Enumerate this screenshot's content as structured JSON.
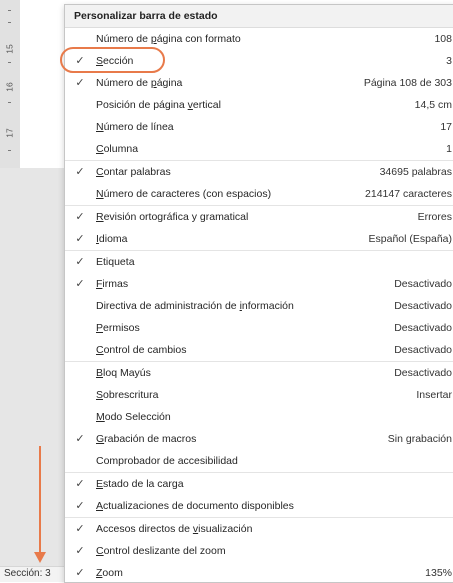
{
  "ruler": {
    "ticks": [
      "15",
      "16",
      "17"
    ]
  },
  "statusbar": {
    "section_label": "Sección: 3"
  },
  "menu": {
    "title": "Personalizar barra de estado",
    "items": [
      {
        "pre": "Número de ",
        "u": "p",
        "post": "ágina con formato",
        "value": "108",
        "checked": false,
        "sep": false
      },
      {
        "pre": "",
        "u": "S",
        "post": "ección",
        "value": "3",
        "checked": true,
        "sep": false
      },
      {
        "pre": "Número de ",
        "u": "p",
        "post": "ágina",
        "value": "Página 108 de 303",
        "checked": true,
        "sep": false
      },
      {
        "pre": "Posición de página ",
        "u": "v",
        "post": "ertical",
        "value": "14,5 cm",
        "checked": false,
        "sep": false
      },
      {
        "pre": "",
        "u": "N",
        "post": "úmero de línea",
        "value": "17",
        "checked": false,
        "sep": false
      },
      {
        "pre": "",
        "u": "C",
        "post": "olumna",
        "value": "1",
        "checked": false,
        "sep": false
      },
      {
        "pre": "",
        "u": "C",
        "post": "ontar palabras",
        "value": "34695 palabras",
        "checked": true,
        "sep": true
      },
      {
        "pre": "",
        "u": "N",
        "post": "úmero de caracteres (con espacios)",
        "value": "214147 caracteres",
        "checked": false,
        "sep": false
      },
      {
        "pre": "",
        "u": "R",
        "post": "evisión ortográfica y gramatical",
        "value": "Errores",
        "checked": true,
        "sep": true
      },
      {
        "pre": "",
        "u": "I",
        "post": "dioma",
        "value": "Español (España)",
        "checked": true,
        "sep": false
      },
      {
        "pre": "Etiqueta",
        "u": "",
        "post": "",
        "value": "",
        "checked": true,
        "sep": true
      },
      {
        "pre": "",
        "u": "F",
        "post": "irmas",
        "value": "Desactivado",
        "checked": true,
        "sep": false
      },
      {
        "pre": "Directiva de administración de ",
        "u": "i",
        "post": "nformación",
        "value": "Desactivado",
        "checked": false,
        "sep": false
      },
      {
        "pre": "",
        "u": "P",
        "post": "ermisos",
        "value": "Desactivado",
        "checked": false,
        "sep": false
      },
      {
        "pre": "",
        "u": "C",
        "post": "ontrol de cambios",
        "value": "Desactivado",
        "checked": false,
        "sep": false
      },
      {
        "pre": "",
        "u": "B",
        "post": "loq Mayús",
        "value": "Desactivado",
        "checked": false,
        "sep": true
      },
      {
        "pre": "",
        "u": "S",
        "post": "obrescritura",
        "value": "Insertar",
        "checked": false,
        "sep": false
      },
      {
        "pre": "",
        "u": "M",
        "post": "odo Selección",
        "value": "",
        "checked": false,
        "sep": false
      },
      {
        "pre": "",
        "u": "G",
        "post": "rabación de macros",
        "value": "Sin grabación",
        "checked": true,
        "sep": false
      },
      {
        "pre": "Comprobador de accesibilidad",
        "u": "",
        "post": "",
        "value": "",
        "checked": false,
        "sep": false
      },
      {
        "pre": "",
        "u": "E",
        "post": "stado de la carga",
        "value": "",
        "checked": true,
        "sep": true
      },
      {
        "pre": "",
        "u": "A",
        "post": "ctualizaciones de documento disponibles",
        "value": "",
        "checked": true,
        "sep": false
      },
      {
        "pre": "Accesos directos de ",
        "u": "v",
        "post": "isualización",
        "value": "",
        "checked": true,
        "sep": true
      },
      {
        "pre": "",
        "u": "C",
        "post": "ontrol deslizante del zoom",
        "value": "",
        "checked": true,
        "sep": false
      },
      {
        "pre": "",
        "u": "Z",
        "post": "oom",
        "value": "135%",
        "checked": true,
        "sep": false
      }
    ]
  },
  "colors": {
    "accent": "#e87a4a",
    "menu_bg": "#ffffff",
    "title_bg": "#f2f2f2"
  },
  "icons": {
    "check": "check-icon",
    "arrow": "arrow-down-icon"
  }
}
